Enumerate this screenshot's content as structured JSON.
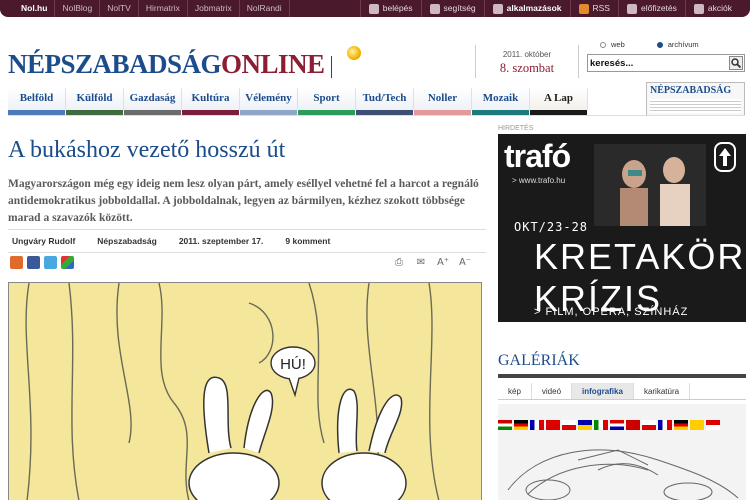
{
  "topbar": {
    "left": [
      "Nol.hu",
      "NolBlog",
      "NolTV",
      "Hirmatrix",
      "Jobmatrix",
      "NolRandi"
    ],
    "right": [
      {
        "icon": "person-icon",
        "label": "belépés"
      },
      {
        "icon": "question-icon",
        "label": "segítség"
      },
      {
        "icon": "apps-icon",
        "label": "alkalmazások",
        "bold": true
      },
      {
        "icon": "rss-icon",
        "label": "RSS"
      },
      {
        "icon": "plus-icon",
        "label": "előfizetés"
      },
      {
        "icon": "star-icon",
        "label": "akciók"
      }
    ]
  },
  "logo": {
    "part1": "NÉPSZABADSÁG",
    "part2": "ONLINE"
  },
  "date": {
    "line1": "2011. október",
    "line2": "8. szombat"
  },
  "search": {
    "radio_web": "web",
    "radio_archive": "archívum",
    "value": "keresés..."
  },
  "nav": {
    "tabs": [
      {
        "label": "Belföld",
        "color": "#4d7ab8"
      },
      {
        "label": "Külföld",
        "color": "#3f6b3f"
      },
      {
        "label": "Gazdaság",
        "color": "#6b6b6b"
      },
      {
        "label": "Kultúra",
        "color": "#7a1f3b"
      },
      {
        "label": "Vélemény",
        "color": "#8ea6c8"
      },
      {
        "label": "Sport",
        "color": "#2d9c5a"
      },
      {
        "label": "Tud/Tech",
        "color": "#3d4f74"
      },
      {
        "label": "Noller",
        "color": "#e29a9a"
      },
      {
        "label": "Mozaik",
        "color": "#1d7a7a"
      },
      {
        "label": "A Lap",
        "color": "#1a1a1a"
      }
    ],
    "newspaper_title": "NÉPSZABADSÁG"
  },
  "article": {
    "title": "A bukáshoz vezető hosszú út",
    "lead": "Magyarországon még egy ideig nem lesz olyan párt, amely eséllyel vehetné fel a harcot a regnáló antidemokratikus jobboldallal. A jobboldalnak, legyen az bármilyen, kézhez szokott többsége marad a szavazók között.",
    "author": "Ungváry Rudolf",
    "source": "Népszabadság",
    "date": "2011. szeptember 17.",
    "comments": "9 komment",
    "cartoon_text": "HÚ!"
  },
  "sidebar": {
    "ad_label": "HIRDETÉS",
    "ad": {
      "brand": "trafó",
      "url": "> www.trafo.hu",
      "date": "OKT/23-28",
      "line1": "KRETAKÖR",
      "line2": "KRÍZIS",
      "footer": "> FILM, OPERA, SZÍNHÁZ"
    },
    "gallery_title": "GALÉRIÁK",
    "gallery_tabs": [
      "kép",
      "videó",
      "infografika",
      "karikatúra"
    ],
    "gallery_active": "infografika"
  },
  "colors": {
    "brand_blue": "#1b4c8c",
    "brand_red": "#8b1e33",
    "topbar": "#4a1a2c"
  }
}
